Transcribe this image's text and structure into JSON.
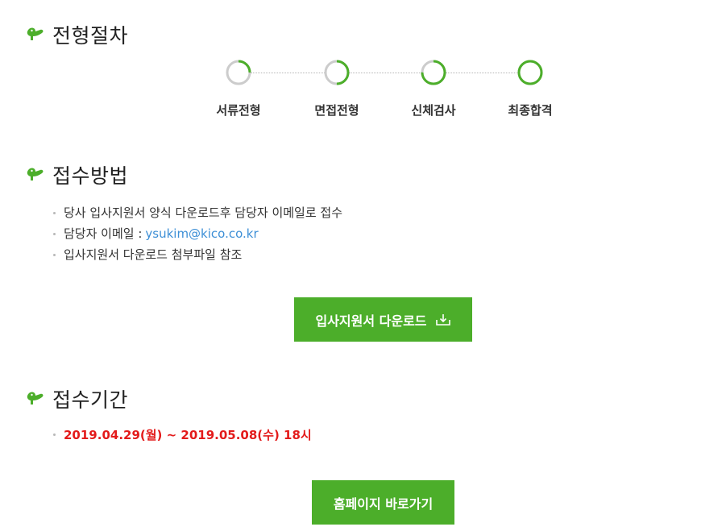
{
  "sections": {
    "steps_title": "전형절차",
    "method_title": "접수방법",
    "period_title": "접수기간"
  },
  "steps": [
    {
      "label": "서류전형",
      "progress": 0.25
    },
    {
      "label": "면접전형",
      "progress": 0.5
    },
    {
      "label": "신체검사",
      "progress": 0.75
    },
    {
      "label": "최종합격",
      "progress": 1.0
    }
  ],
  "method": {
    "items": [
      "당사 입사지원서 양식 다운로드후 담당자 이메일로 접수",
      "담당자 이메일 :",
      "입사지원서 다운로드 첨부파일 참조"
    ],
    "email": "ysukim@kico.co.kr"
  },
  "download_button": {
    "label": "입사지원서 다운로드",
    "icon": "download-icon"
  },
  "period": {
    "text": "2019.04.29(월) ~ 2019.05.08(수) 18시"
  },
  "home_button": {
    "label": "홈페이지 바로가기"
  },
  "colors": {
    "accent": "#4cae2a",
    "ring_track": "#cccccc",
    "link": "#3d8fd6",
    "period": "#e31b1b"
  }
}
